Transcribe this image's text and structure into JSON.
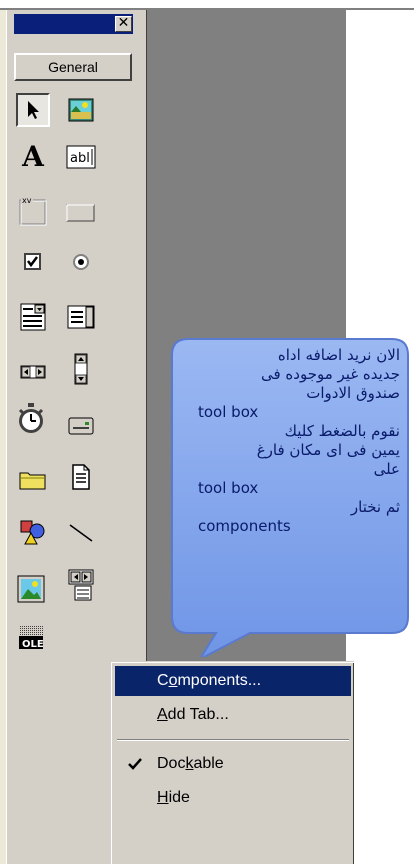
{
  "toolbox": {
    "close_glyph": "✕",
    "tab_label": "General",
    "tools": [
      {
        "name": "pointer-icon"
      },
      {
        "name": "picturebox-icon"
      },
      {
        "name": "label-icon"
      },
      {
        "name": "textbox-icon"
      },
      {
        "name": "frame-icon"
      },
      {
        "name": "commandbutton-icon"
      },
      {
        "name": "checkbox-icon"
      },
      {
        "name": "optionbutton-icon"
      },
      {
        "name": "combobox-icon"
      },
      {
        "name": "listbox-icon"
      },
      {
        "name": "hscrollbar-icon"
      },
      {
        "name": "vscrollbar-icon"
      },
      {
        "name": "timer-icon"
      },
      {
        "name": "drivelistbox-icon"
      },
      {
        "name": "dirlistbox-icon"
      },
      {
        "name": "filelistbox-icon"
      },
      {
        "name": "shape-icon"
      },
      {
        "name": "line-icon"
      },
      {
        "name": "image-icon"
      },
      {
        "name": "data-icon"
      },
      {
        "name": "ole-icon"
      }
    ],
    "ole_text": "OLE"
  },
  "callout": {
    "lines": [
      {
        "text": "الان نريد اضافه اداه",
        "dir": "rtl"
      },
      {
        "text": "جديده غير موجوده فى",
        "dir": "rtl"
      },
      {
        "text": "صندوق الادوات",
        "dir": "rtl"
      },
      {
        "text": "tool box",
        "dir": "ltr"
      },
      {
        "text": "نقوم بالضغط كليك",
        "dir": "rtl"
      },
      {
        "text": "يمين فى اى مكان فارغ",
        "dir": "rtl"
      },
      {
        "text": "على",
        "dir": "rtl"
      },
      {
        "text": "tool box",
        "dir": "ltr"
      },
      {
        "text": "ثم نختار",
        "dir": "rtl"
      },
      {
        "text": "components",
        "dir": "ltr"
      }
    ],
    "fill_color": "#7ea3ec",
    "text_color": "#0a1a6a"
  },
  "context_menu": {
    "items": [
      {
        "pre": "C",
        "u": "o",
        "post": "mponents...",
        "highlighted": true
      },
      {
        "pre": "",
        "u": "A",
        "post": "dd Tab...",
        "highlighted": false
      },
      {
        "pre": "Doc",
        "u": "k",
        "post": "able",
        "checked": true
      },
      {
        "pre": "",
        "u": "H",
        "post": "ide",
        "highlighted": false
      }
    ],
    "highlight_color": "#0a246a"
  }
}
